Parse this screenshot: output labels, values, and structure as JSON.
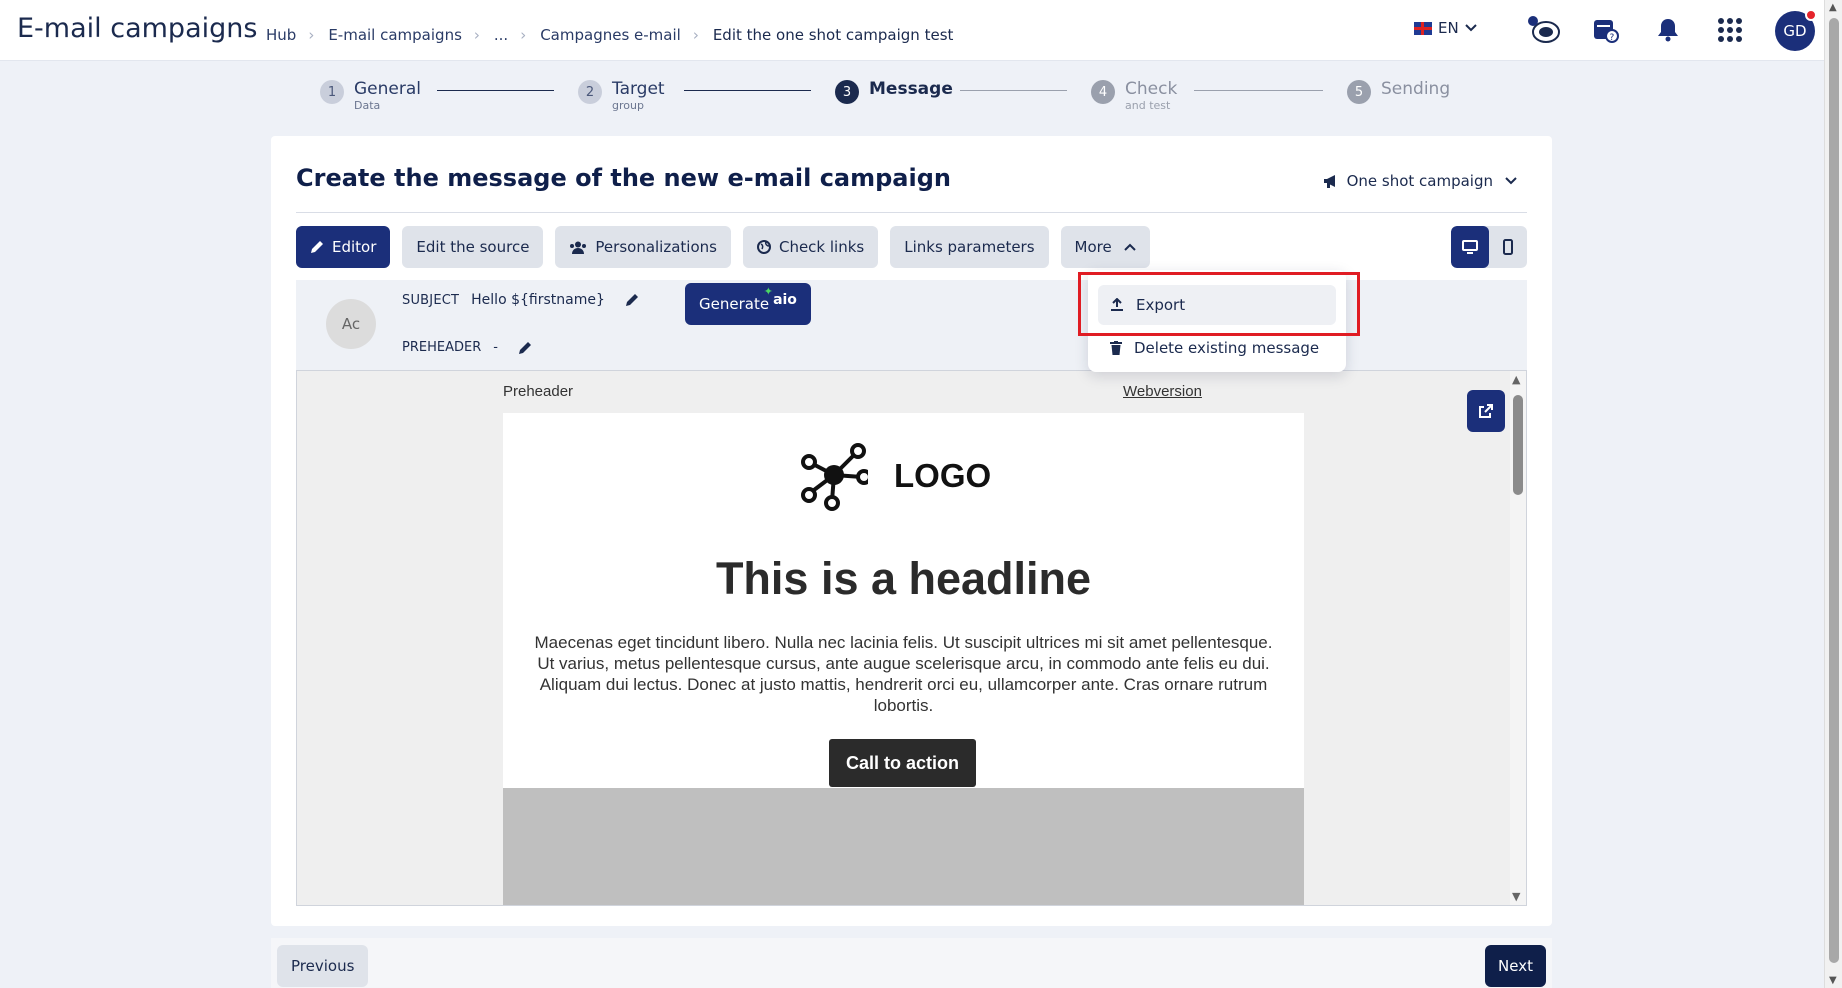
{
  "app": {
    "title": "E-mail campaigns"
  },
  "breadcrumb": [
    "Hub",
    "E-mail campaigns",
    "...",
    "Campagnes e-mail",
    "Edit the one shot campaign test"
  ],
  "header": {
    "language": "EN",
    "user_initials": "GD",
    "notification_dot_color": "#e5242b"
  },
  "stepper": [
    {
      "num": "1",
      "label": "General",
      "sub": "Data"
    },
    {
      "num": "2",
      "label": "Target",
      "sub": "group"
    },
    {
      "num": "3",
      "label": "Message",
      "sub": ""
    },
    {
      "num": "4",
      "label": "Check",
      "sub": "and test"
    },
    {
      "num": "5",
      "label": "Sending",
      "sub": ""
    }
  ],
  "card": {
    "title": "Create the message of the new e-mail campaign",
    "campaign_type": "One shot campaign"
  },
  "toolbar": {
    "editor": "Editor",
    "edit_source": "Edit the source",
    "personalizations": "Personalizations",
    "check_links": "Check links",
    "links_parameters": "Links parameters",
    "more": "More"
  },
  "subject": {
    "avatar": "Ac",
    "subject_key": "SUBJECT",
    "subject_value": "Hello ${firstname}",
    "generate": "Generate",
    "generate_badge": "aio",
    "preheader_key": "PREHEADER",
    "preheader_value": "-"
  },
  "dropdown": {
    "export": "Export",
    "delete": "Delete existing message"
  },
  "preview": {
    "preheader": "Preheader",
    "webversion": "Webversion",
    "logo": "LOGO",
    "headline": "This is a headline",
    "body": "Maecenas eget tincidunt libero. Nulla nec lacinia felis. Ut suscipit ultrices mi sit amet pellentesque. Ut varius, metus pellentesque cursus, ante augue scelerisque arcu, in commodo ante felis eu dui. Aliquam dui lectus. Donec at justo mattis, hendrerit orci eu, ullamcorper ante. Cras ornare rutrum lobortis.",
    "cta": "Call to action"
  },
  "footer": {
    "previous": "Previous",
    "next": "Next"
  },
  "colors": {
    "primary": "#1b2f7a",
    "highlight": "#e01c23"
  }
}
